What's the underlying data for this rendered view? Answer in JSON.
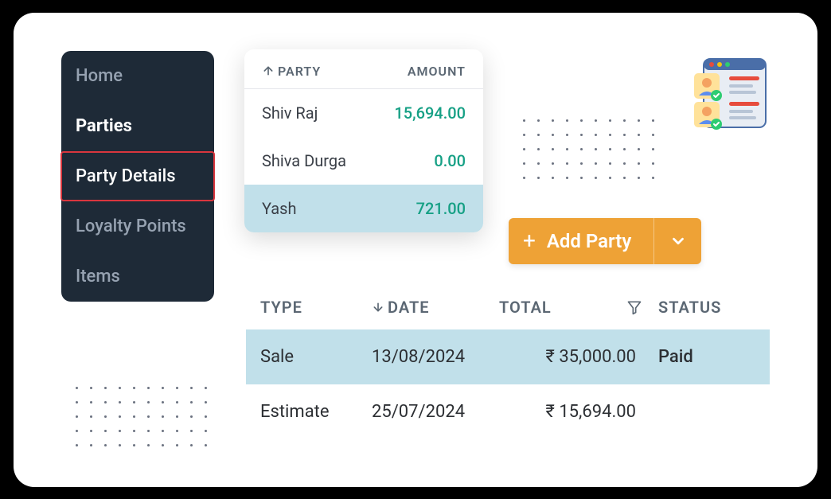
{
  "sidebar": {
    "items": [
      {
        "label": "Home"
      },
      {
        "label": "Parties"
      },
      {
        "label": "Party Details"
      },
      {
        "label": "Loyalty Points"
      },
      {
        "label": "Items"
      }
    ]
  },
  "party_list": {
    "headers": {
      "party": "PARTY",
      "amount": "AMOUNT"
    },
    "rows": [
      {
        "name": "Shiv Raj",
        "amount": "15,694.00"
      },
      {
        "name": "Shiva Durga",
        "amount": "0.00"
      },
      {
        "name": "Yash",
        "amount": "721.00",
        "selected": true
      }
    ]
  },
  "add_party": {
    "label": "Add Party",
    "icon": "plus-icon",
    "dropdown_icon": "chevron-down-icon"
  },
  "transactions": {
    "headers": {
      "type": "TYPE",
      "date": "DATE",
      "total": "TOTAL",
      "status": "STATUS",
      "filter_icon": "filter-icon",
      "sort_icon": "sort-desc-icon"
    },
    "rows": [
      {
        "type": "Sale",
        "date": "13/08/2024",
        "total": "₹ 35,000.00",
        "status": "Paid",
        "selected": true
      },
      {
        "type": "Estimate",
        "date": "25/07/2024",
        "total": "₹ 15,694.00",
        "status": ""
      }
    ]
  },
  "colors": {
    "accent": "#eea236",
    "positive": "#16a085",
    "highlight": "#c1e0ea",
    "sidebar_bg": "#1e2a37",
    "danger_border": "#d9363e"
  }
}
